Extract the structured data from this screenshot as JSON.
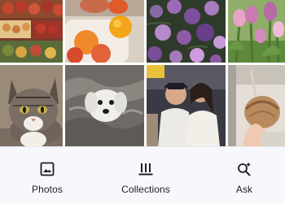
{
  "photo_grid": {
    "photos": [
      {
        "subject": "market-fruit"
      },
      {
        "subject": "fruit-bowl"
      },
      {
        "subject": "purple-flowers"
      },
      {
        "subject": "pink-tulips"
      },
      {
        "subject": "tabby-cat"
      },
      {
        "subject": "white-dog-on-blanket"
      },
      {
        "subject": "friends-selfie"
      },
      {
        "subject": "coconut-drink"
      }
    ]
  },
  "bottom_nav": {
    "items": [
      {
        "label": "Photos",
        "icon": "photo-icon",
        "selected": true
      },
      {
        "label": "Collections",
        "icon": "collections-icon",
        "selected": false
      },
      {
        "label": "Ask",
        "icon": "ask-sparkle-search-icon",
        "selected": false
      }
    ]
  },
  "colors": {
    "nav_background": "#f6f8fc",
    "icon": "#1f1f1f",
    "label": "#1f1f1f"
  }
}
